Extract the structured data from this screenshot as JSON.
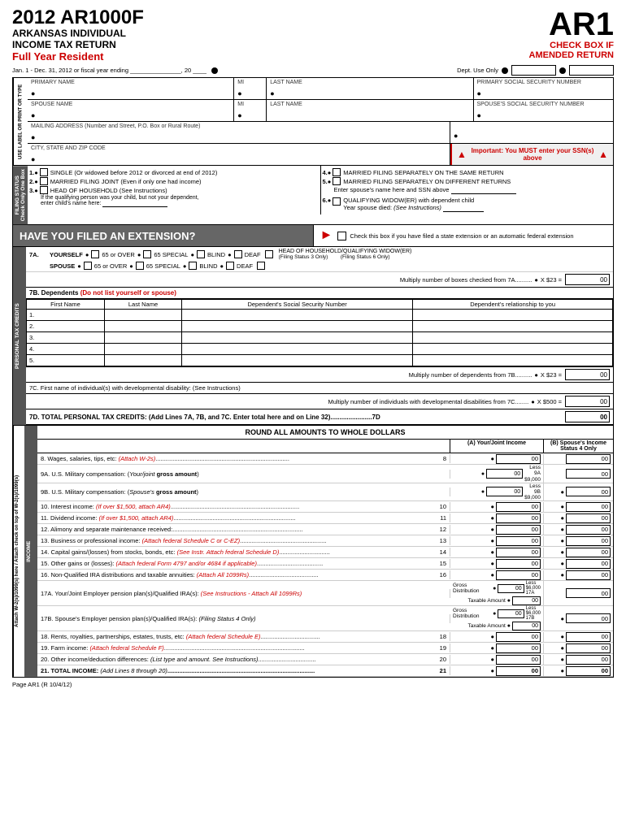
{
  "header": {
    "form_title": "2012 AR1000F",
    "subtitle1": "ARKANSAS INDIVIDUAL",
    "subtitle2": "INCOME TAX RETURN",
    "subtitle3": "Full Year Resident",
    "ar1_label": "AR1",
    "check_box_if": "CHECK BOX IF",
    "amended_return": "AMENDED RETURN",
    "dept_use_only": "Dept. Use Only",
    "fiscal_year_line": "Jan. 1 - Dec. 31, 2012 or fiscal year ending _______________, 20 ____"
  },
  "form_fields": {
    "primary_name_label": "PRIMARY NAME",
    "mi_label": "MI",
    "last_name_label": "LAST NAME",
    "ssn_label": "PRIMARY SOCIAL SECURITY NUMBER",
    "spouse_name_label": "SPOUSE NAME",
    "spouse_ssn_label": "SPOUSE'S SOCIAL SECURITY NUMBER",
    "mailing_address_label": "MAILING ADDRESS (Number and Street, P.O. Box or Rural Route)",
    "city_state_zip_label": "CITY, STATE AND ZIP CODE",
    "important_msg": "Important: You MUST enter your SSN(s) above"
  },
  "filing_status": {
    "header": "FILING STATUS Check Only One Box",
    "options": [
      {
        "num": "1.",
        "label": "SINGLE (Or widowed before 2012 or divorced at end of 2012)"
      },
      {
        "num": "2.",
        "label": "MARRIED FILING JOINT (Even if only one had income)"
      },
      {
        "num": "3.",
        "label": "HEAD OF HOUSEHOLD (See Instructions)"
      }
    ],
    "right_options": [
      {
        "num": "4.",
        "label": "MARRIED FILING SEPARATELY ON THE SAME RETURN"
      },
      {
        "num": "5.",
        "label": "MARRIED FILING SEPARATELY ON DIFFERENT RETURNS"
      },
      {
        "num": "6.",
        "label": "QUALIFYING WIDOW(ER) with dependent child Year spouse died: (See Instructions) ______"
      }
    ],
    "qualifying_note": "If the qualifying person was your child, but not your dependent, enter child's name here: _______________",
    "enter_spouse_ssn": "Enter spouse's name here and SSN above _______________",
    "state_ext_note": "Check this box if you have filed a state extension or an automatic federal extension"
  },
  "extension": {
    "header": "HAVE YOU FILED AN EXTENSION?",
    "note": "Check this box if you have filed a state extension or an automatic federal extension"
  },
  "line7a": {
    "yourself": "YOURSELF",
    "65_or_over": "65 or OVER",
    "65_special": "65 SPECIAL",
    "blind": "BLIND",
    "deaf": "DEAF",
    "head_of_household": "HEAD OF HOUSEHOLD/QUALIFYING WIDOW(ER)",
    "filing_status_3": "(Filing Status 3 Only)",
    "filing_status_6": "(Filing Status 6 Only)",
    "spouse": "SPOUSE",
    "multiply_text": "Multiply number of boxes checked from 7A..........",
    "x23": "X $23 =",
    "amount_00": "00"
  },
  "line7b": {
    "header": "7B. Dependents (Do not list yourself or spouse)",
    "col1": "First Name",
    "col2": "Last Name",
    "col3": "Dependent's Social Security Number",
    "col4": "Dependent's relationship to you",
    "rows": [
      "1.",
      "2.",
      "3.",
      "4.",
      "5."
    ],
    "multiply_text": "Multiply number of dependents from 7B..........",
    "x23": "X $23 =",
    "amount_00": "00"
  },
  "line7c": {
    "text": "7C. First name of individual(s) with developmental disability: (See Instructions)",
    "multiply_text": "Multiply number of individuals with developmental disabilities from 7C........",
    "x500": "X $500 =",
    "amount_00": "00"
  },
  "line7d": {
    "text": "7D. TOTAL PERSONAL TAX CREDITS: (Add Lines 7A, 7B, and 7C. Enter total here and on Line 32).......................7D",
    "amount_00": "00"
  },
  "income": {
    "round_header": "ROUND ALL AMOUNTS TO WHOLE DOLLARS",
    "col_a_header": "(A) Your/Joint Income",
    "col_b_header": "(B) Spouse's Income Status 4 Only",
    "lines": [
      {
        "num": "8.",
        "label": "Wages, salaries, tips, etc: (Attach W-2s)...............................................................................",
        "line_num": "8"
      },
      {
        "num": "9A.",
        "label": "U.S. Military compensation: (Your/joint gross amount)",
        "has_less": true,
        "less_label": "Less 9A",
        "less_val": "$9,000"
      },
      {
        "num": "9B.",
        "label": "U.S. Military compensation: (Spouse's gross amount)",
        "has_less": true,
        "less_label": "Less 9B",
        "less_val": "$9,000"
      },
      {
        "num": "10.",
        "label": "Interest income: (If over $1,500, attach AR4)...........................................................................",
        "line_num": "10"
      },
      {
        "num": "11.",
        "label": "Dividend income: (If over $1,500, attach AR4).........................................................................",
        "line_num": "11"
      },
      {
        "num": "12.",
        "label": "Alimony and separate maintenance received:.............................................................................",
        "line_num": "12"
      },
      {
        "num": "13.",
        "label": "Business or professional income: (Attach federal Schedule C or C-EZ)...................................................",
        "line_num": "13"
      },
      {
        "num": "14.",
        "label": "Capital gains/(losses) from stocks, bonds, etc: (See Instr. Attach federal Schedule D)..............................",
        "line_num": "14"
      },
      {
        "num": "15.",
        "label": "Other gains or (losses): (Attach federal Form 4797 and/or 4684 if applicable).......................................",
        "line_num": "15"
      },
      {
        "num": "16.",
        "label": "Non-Qualified IRA distributions and taxable annuities: (Attach All 1099Rs).........................................",
        "line_num": "16"
      },
      {
        "num": "17A.",
        "label": "17A.Your/Joint Employer pension plan(s)/Qualified IRA(s): (See Instructions - Attach All 1099Rs)"
      },
      {
        "num": "17B.",
        "label": "17B.Spouse's Employer pension plan(s)/Qualified IRA(s): (Filing Status 4 Only)"
      },
      {
        "num": "18.",
        "label": "Rents, royalties, partnerships, estates, trusts, etc: (Attach federal Schedule E)...................................",
        "line_num": "18"
      },
      {
        "num": "19.",
        "label": "Farm income: (Attach federal Schedule F)...................................................................................",
        "line_num": "19"
      },
      {
        "num": "20.",
        "label": "Other income/deduction differences: (List type and amount. See Instructions)..................................",
        "line_num": "20"
      },
      {
        "num": "21.",
        "label": "TOTAL INCOME: (Add Lines 8 through 20).......................................................................................",
        "line_num": "21"
      }
    ],
    "line17a_gross_dist": "Gross Distribution",
    "line17a_taxable": "Taxable Amount",
    "line17a_less": "Less $6,000",
    "line17a_label": "17A",
    "line17b_gross_dist": "Gross Distribution",
    "line17b_taxable": "Taxable Amount",
    "line17b_less": "Less $6,000",
    "line17b_label": "17B"
  },
  "attach_side": {
    "text": "Attach W-2(s)/1099(s) here / Attach check on top of W-2(s)/1099(s)"
  },
  "income_side": {
    "text": "INCOME"
  },
  "page_footer": {
    "text": "Page AR1 (R 10/4/12)"
  }
}
